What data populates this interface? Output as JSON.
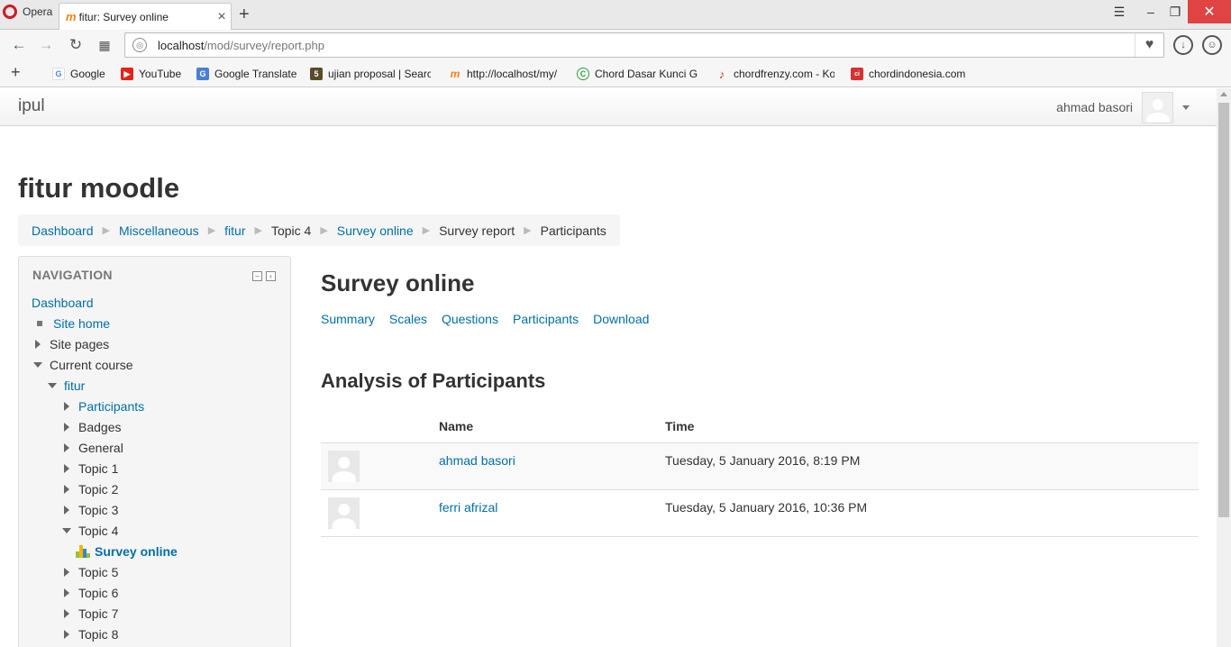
{
  "browser": {
    "name": "Opera",
    "tab_title": "fitur: Survey online",
    "url_host": "localhost",
    "url_path": "/mod/survey/report.php",
    "bookmarks": [
      {
        "label": "Google",
        "color": "#4285f4",
        "glyph": "G"
      },
      {
        "label": "YouTube",
        "color": "#e62117",
        "glyph": "▶"
      },
      {
        "label": "Google Translate",
        "color": "#4a7fd8",
        "glyph": "G"
      },
      {
        "label": "ujian proposal | Searc",
        "color": "#5a4a2a",
        "glyph": "5"
      },
      {
        "label": "http://localhost/my/",
        "color": "#f98012",
        "glyph": "m"
      },
      {
        "label": "Chord Dasar Kunci Gi",
        "color": "#2a9a3a",
        "glyph": "C"
      },
      {
        "label": "chordfrenzy.com - Ko",
        "color": "#c0392b",
        "glyph": "♪"
      },
      {
        "label": "chordindonesia.com",
        "color": "#d93030",
        "glyph": "ci"
      }
    ]
  },
  "site": {
    "brand": "ipul",
    "user_name": "ahmad basori",
    "title": "fitur moodle"
  },
  "breadcrumb": [
    {
      "label": "Dashboard",
      "link": true
    },
    {
      "label": "Miscellaneous",
      "link": true
    },
    {
      "label": "fitur",
      "link": true
    },
    {
      "label": "Topic 4",
      "link": false
    },
    {
      "label": "Survey online",
      "link": true
    },
    {
      "label": "Survey report",
      "link": false
    },
    {
      "label": "Participants",
      "link": false
    }
  ],
  "navigation": {
    "header": "NAVIGATION",
    "items": [
      {
        "label": "Dashboard",
        "link": true,
        "level": 0,
        "marker": "none"
      },
      {
        "label": "Site home",
        "link": true,
        "level": 0,
        "marker": "bullet"
      },
      {
        "label": "Site pages",
        "link": false,
        "level": 0,
        "marker": "right"
      },
      {
        "label": "Current course",
        "link": false,
        "level": 0,
        "marker": "down"
      },
      {
        "label": "fitur",
        "link": true,
        "level": 1,
        "marker": "down"
      },
      {
        "label": "Participants",
        "link": true,
        "level": 2,
        "marker": "right"
      },
      {
        "label": "Badges",
        "link": false,
        "level": 2,
        "marker": "right"
      },
      {
        "label": "General",
        "link": false,
        "level": 2,
        "marker": "right"
      },
      {
        "label": "Topic 1",
        "link": false,
        "level": 2,
        "marker": "right"
      },
      {
        "label": "Topic 2",
        "link": false,
        "level": 2,
        "marker": "right"
      },
      {
        "label": "Topic 3",
        "link": false,
        "level": 2,
        "marker": "right"
      },
      {
        "label": "Topic 4",
        "link": false,
        "level": 2,
        "marker": "down"
      },
      {
        "label": "Survey online",
        "link": true,
        "level": 3,
        "marker": "survey",
        "active": true
      },
      {
        "label": "Topic 5",
        "link": false,
        "level": 2,
        "marker": "right"
      },
      {
        "label": "Topic 6",
        "link": false,
        "level": 2,
        "marker": "right"
      },
      {
        "label": "Topic 7",
        "link": false,
        "level": 2,
        "marker": "right"
      },
      {
        "label": "Topic 8",
        "link": false,
        "level": 2,
        "marker": "right"
      }
    ]
  },
  "main": {
    "title": "Survey online",
    "tabs": [
      "Summary",
      "Scales",
      "Questions",
      "Participants",
      "Download"
    ],
    "section_title": "Analysis of Participants",
    "table": {
      "headers": [
        "",
        "Name",
        "Time"
      ],
      "rows": [
        {
          "name": "ahmad basori",
          "time": "Tuesday, 5 January 2016, 8:19 PM"
        },
        {
          "name": "ferri afrizal",
          "time": "Tuesday, 5 January 2016, 10:36 PM"
        }
      ]
    }
  },
  "colors": {
    "link": "#0070a8",
    "moodle_orange": "#f98012"
  }
}
